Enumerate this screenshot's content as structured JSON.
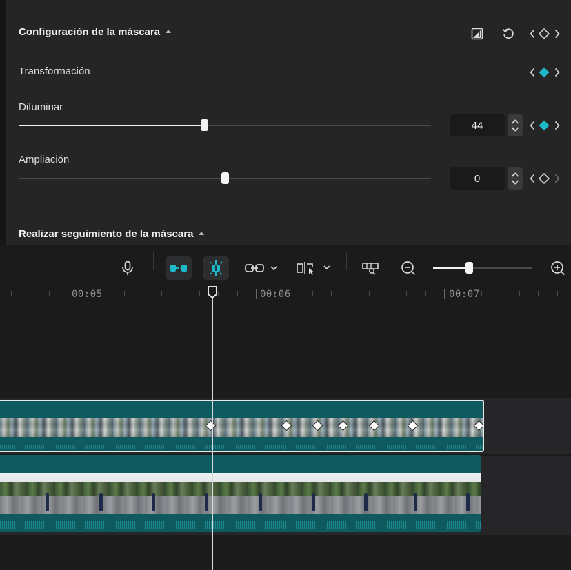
{
  "mask_panel": {
    "title": "Configuración de la máscara",
    "transform_label": "Transformación",
    "blur": {
      "label": "Difuminar",
      "value": "44",
      "fraction": 0.45
    },
    "expand": {
      "label": "Ampliación",
      "value": "0",
      "fraction": 0.5
    },
    "tracking_title": "Realizar seguimiento de la máscara"
  },
  "icons": {
    "invert": "invert-mask-icon",
    "reset": "reset-icon",
    "prev": "chevron-left-icon",
    "next": "chevron-right-icon",
    "keyframe": "keyframe-diamond-icon"
  },
  "colors": {
    "accent": "#1fb8c9",
    "clip": "#0f5a5e",
    "panel": "#252526",
    "background": "#1b1b1c"
  },
  "toolbar": {
    "items": [
      "mic-icon",
      "auto-snap-icon",
      "split-marker-icon",
      "link-icon",
      "preview-axis-icon",
      "thumbnail-icon",
      "zoom-out-icon",
      "zoom-in-icon"
    ],
    "zoom_fraction": 0.36
  },
  "timeline": {
    "timecodes": [
      "00:05",
      "00:06",
      "00:07"
    ]
  }
}
